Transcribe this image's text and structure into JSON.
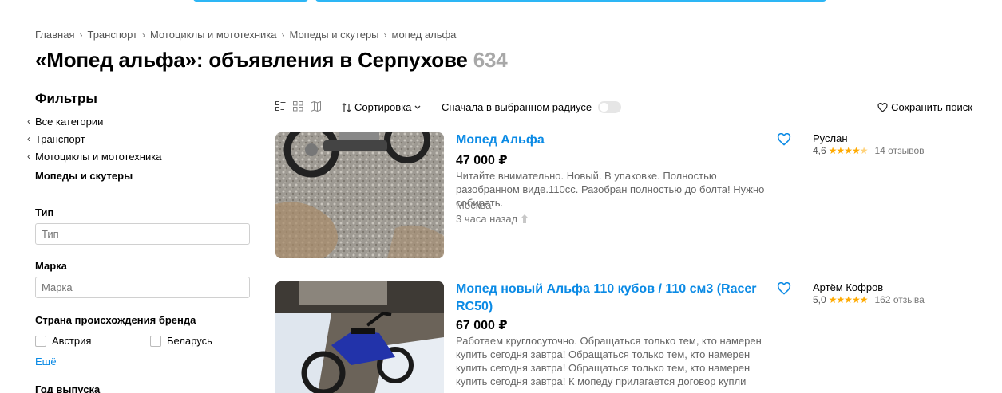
{
  "breadcrumb": [
    "Главная",
    "Транспорт",
    "Мотоциклы и мототехника",
    "Мопеды и скутеры",
    "мопед альфа"
  ],
  "title": {
    "text": "«Мопед альфа»: объявления в Серпухове",
    "count": "634"
  },
  "filters": {
    "heading": "Фильтры",
    "categories": [
      "Все категории",
      "Транспорт",
      "Мотоциклы и мототехника"
    ],
    "current_category": "Мопеды и скутеры",
    "type_label": "Тип",
    "type_placeholder": "Тип",
    "brand_label": "Марка",
    "brand_placeholder": "Марка",
    "country_label": "Страна происхождения бренда",
    "countries": [
      "Австрия",
      "Беларусь"
    ],
    "more": "Ещё",
    "year_label": "Год выпуска"
  },
  "toolbar": {
    "sort_label": "Сортировка",
    "radius_label": "Сначала в выбранном радиусе",
    "save_search": "Сохранить поиск"
  },
  "listings": [
    {
      "title": "Мопед Альфа",
      "price": "47 000 ₽",
      "description": "Читайте внимательно. Новый. В упаковке. Полностью разобранном виде.110сс. Разобран полностью до болта! Нужно собирать.",
      "location": "Москва",
      "time": "3 часа назад",
      "seller": "Руслан",
      "rating": "4,6",
      "stars": 4.6,
      "reviews": "14 отзывов"
    },
    {
      "title": "Мопед новый Альфа 110 кубов / 110 см3 (Racer RC50)",
      "price": "67 000 ₽",
      "description": "Работаем круглосуточно. Обращаться только тем, кто намерен купить сегодня завтра! Обращаться только тем, кто намерен купить сегодня завтра! Обращаться только тем, кто намерен купить сегодня завтра! К мопеду прилагается договор купли продажи с...",
      "seller": "Артём Кофров",
      "rating": "5,0",
      "stars": 5.0,
      "reviews": "162 отзыва"
    }
  ],
  "colors": {
    "accent": "#0a8ae5",
    "top_bar": "#2db6f5",
    "star": "#ffaa00",
    "count_gray": "#a8a8a8"
  }
}
